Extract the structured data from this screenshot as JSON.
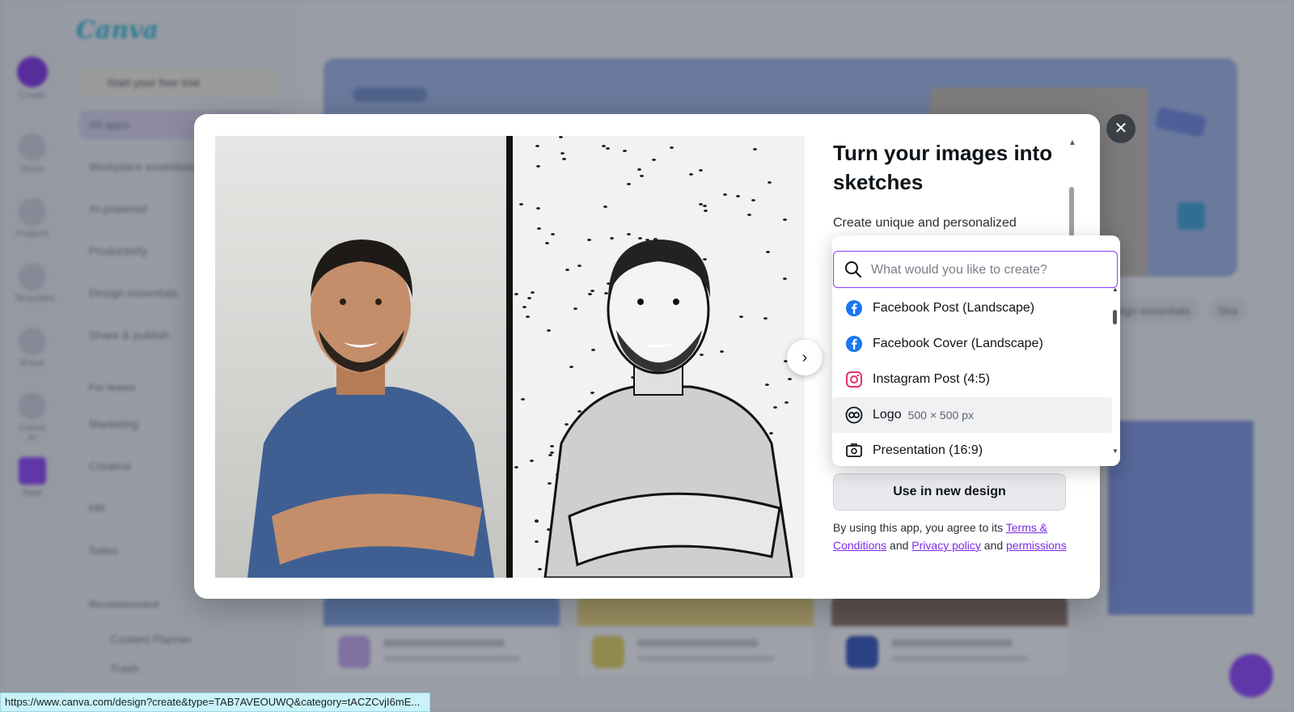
{
  "background": {
    "logo": "Canva",
    "trial_label": "Start your free trial",
    "rail_items": [
      "Create",
      "Home",
      "Projects",
      "Templates",
      "Brand",
      "Canva AI",
      "Apps"
    ],
    "side_items": [
      "All apps",
      "Workplace essentials",
      "AI-powered",
      "Productivity",
      "Design essentials",
      "Share & publish"
    ],
    "side_heading_teams": "For teams",
    "team_items": [
      "Marketing",
      "Creative",
      "HR",
      "Sales"
    ],
    "side_heading_recommended": "Recommended",
    "recommended_items": [
      "Content Planner",
      "Trash"
    ],
    "chips": [
      "Design essentials",
      "Sha"
    ]
  },
  "modal": {
    "close_icon": "✕",
    "next_icon": "›",
    "title": "Turn your images into sketches",
    "description": "Create unique and personalized",
    "use_button": "Use in new design",
    "terms": {
      "prefix": "By using this app, you agree to its ",
      "terms_link": "Terms & Conditions",
      "and1": " and ",
      "privacy_link": "Privacy policy",
      "and2": " and ",
      "permissions_link": "permissions"
    }
  },
  "dropdown": {
    "search_placeholder": "What would you like to create?",
    "items": [
      {
        "label": "Facebook Post (Landscape)",
        "icon": "facebook-icon",
        "dim": ""
      },
      {
        "label": "Facebook Cover (Landscape)",
        "icon": "facebook-icon",
        "dim": ""
      },
      {
        "label": "Instagram Post (4:5)",
        "icon": "instagram-icon",
        "dim": ""
      },
      {
        "label": "Logo",
        "icon": "logo-icon",
        "dim": "500 × 500 px"
      },
      {
        "label": "Presentation (16:9)",
        "icon": "presentation-icon",
        "dim": ""
      }
    ]
  },
  "status_url": "https://www.canva.com/design?create&type=TAB7AVEOUWQ&category=tACZCvjI6mE...",
  "colors": {
    "accent": "#8b3dff",
    "link": "#7d2ae8",
    "facebook": "#1877f2",
    "instagram": "#e1306c"
  }
}
